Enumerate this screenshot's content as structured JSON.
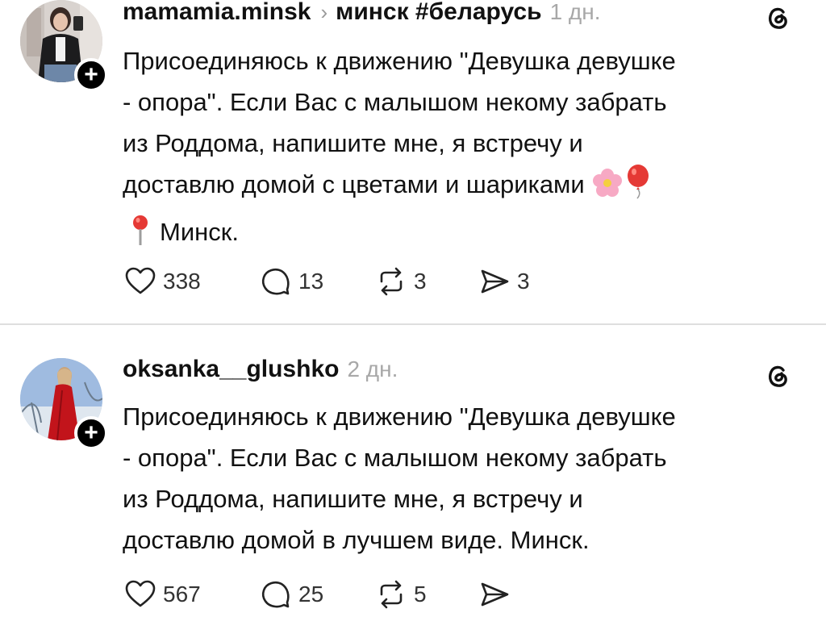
{
  "posts": [
    {
      "username": "mamamia.minsk",
      "topic": "минск #беларусь",
      "time": "1 дн.",
      "body_lines": [
        "Присоединяюсь к движению \"Девушка девушке",
        "- опора\". Если Вас с малышом некому забрать",
        "из Роддома, напишите мне, я встречу и",
        "доставлю домой с цветами и шариками",
        "Минск."
      ],
      "emoji": [
        "cherry-blossom",
        "balloon",
        "round-pushpin"
      ],
      "likes": "338",
      "replies": "13",
      "reposts": "3",
      "shares": "3"
    },
    {
      "username": "oksanka__glushko",
      "time": "2 дн.",
      "body_lines": [
        "Присоединяюсь к движению \"Девушка девушке",
        "- опора\". Если Вас с малышом некому забрать",
        "из Роддома, напишите мне, я встречу и",
        "доставлю домой в лучшем виде. Минск."
      ],
      "likes": "567",
      "replies": "25",
      "reposts": "5"
    }
  ],
  "icons": {
    "follow": "plus-icon",
    "app": "threads-logo-icon",
    "like": "heart-icon",
    "reply": "comment-icon",
    "repost": "repost-icon",
    "share": "send-icon"
  },
  "colors": {
    "text": "#111111",
    "muted": "#a8a8a8",
    "divider": "#dedede",
    "badge": "#000000"
  }
}
